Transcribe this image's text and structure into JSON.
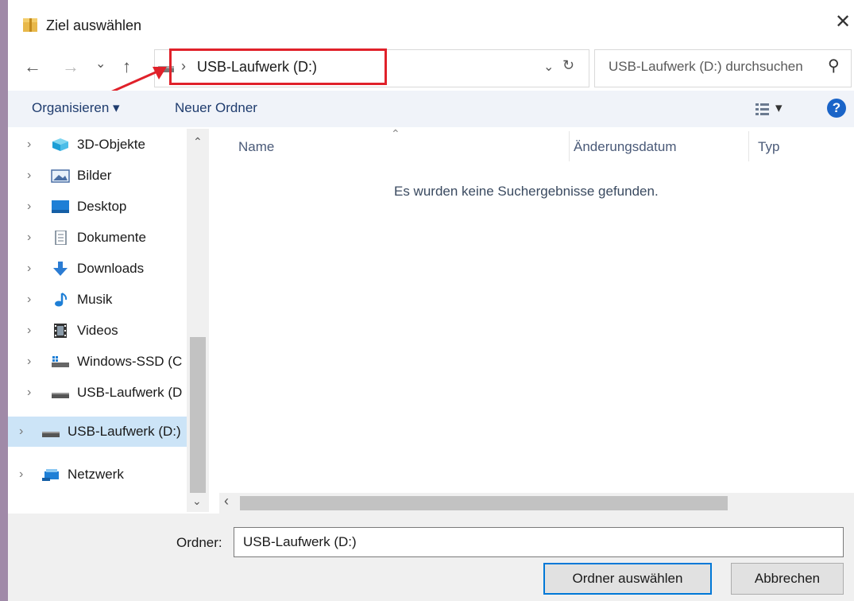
{
  "window": {
    "title": "Ziel auswählen",
    "close_glyph": "✕"
  },
  "nav_buttons": {
    "back": "←",
    "forward": "→",
    "recent": "⌄",
    "up": "↑"
  },
  "address": {
    "separator": "›",
    "path": "USB-Laufwerk (D:)",
    "dropdown": "⌄",
    "refresh": "↻"
  },
  "search": {
    "placeholder": "USB-Laufwerk (D:) durchsuchen",
    "icon": "⚲"
  },
  "toolbar": {
    "organize": "Organisieren ▾",
    "new_folder": "Neuer Ordner",
    "view_arrow": "▾",
    "help": "?"
  },
  "sidebar": {
    "items": [
      {
        "label": "3D-Objekte",
        "icon": "cube-icon"
      },
      {
        "label": "Bilder",
        "icon": "pictures-icon"
      },
      {
        "label": "Desktop",
        "icon": "desktop-icon"
      },
      {
        "label": "Dokumente",
        "icon": "documents-icon"
      },
      {
        "label": "Downloads",
        "icon": "download-arrow-icon"
      },
      {
        "label": "Musik",
        "icon": "music-note-icon"
      },
      {
        "label": "Videos",
        "icon": "film-icon"
      },
      {
        "label": "Windows-SSD (C",
        "icon": "ssd-drive-icon"
      },
      {
        "label": "USB-Laufwerk (D",
        "icon": "usb-drive-icon"
      },
      {
        "label": "USB-Laufwerk (D:)",
        "icon": "usb-drive-icon",
        "selected": true
      },
      {
        "label": "Netzwerk",
        "icon": "network-icon"
      }
    ],
    "chevron": "›",
    "scroll_up": "⌃",
    "scroll_down": "⌄"
  },
  "columns": {
    "name": "Name",
    "date": "Änderungsdatum",
    "type": "Typ",
    "sort_indicator": "⌃"
  },
  "content": {
    "empty_message": "Es wurden keine Suchergebnisse gefunden.",
    "scroll_left": "‹"
  },
  "footer": {
    "folder_label": "Ordner:",
    "folder_value": "USB-Laufwerk (D:)",
    "select_button": "Ordner auswählen",
    "cancel_button": "Abbrechen"
  },
  "colors": {
    "accent": "#0078d7",
    "highlight_box": "#e0212a",
    "selection": "#cce4f7"
  }
}
